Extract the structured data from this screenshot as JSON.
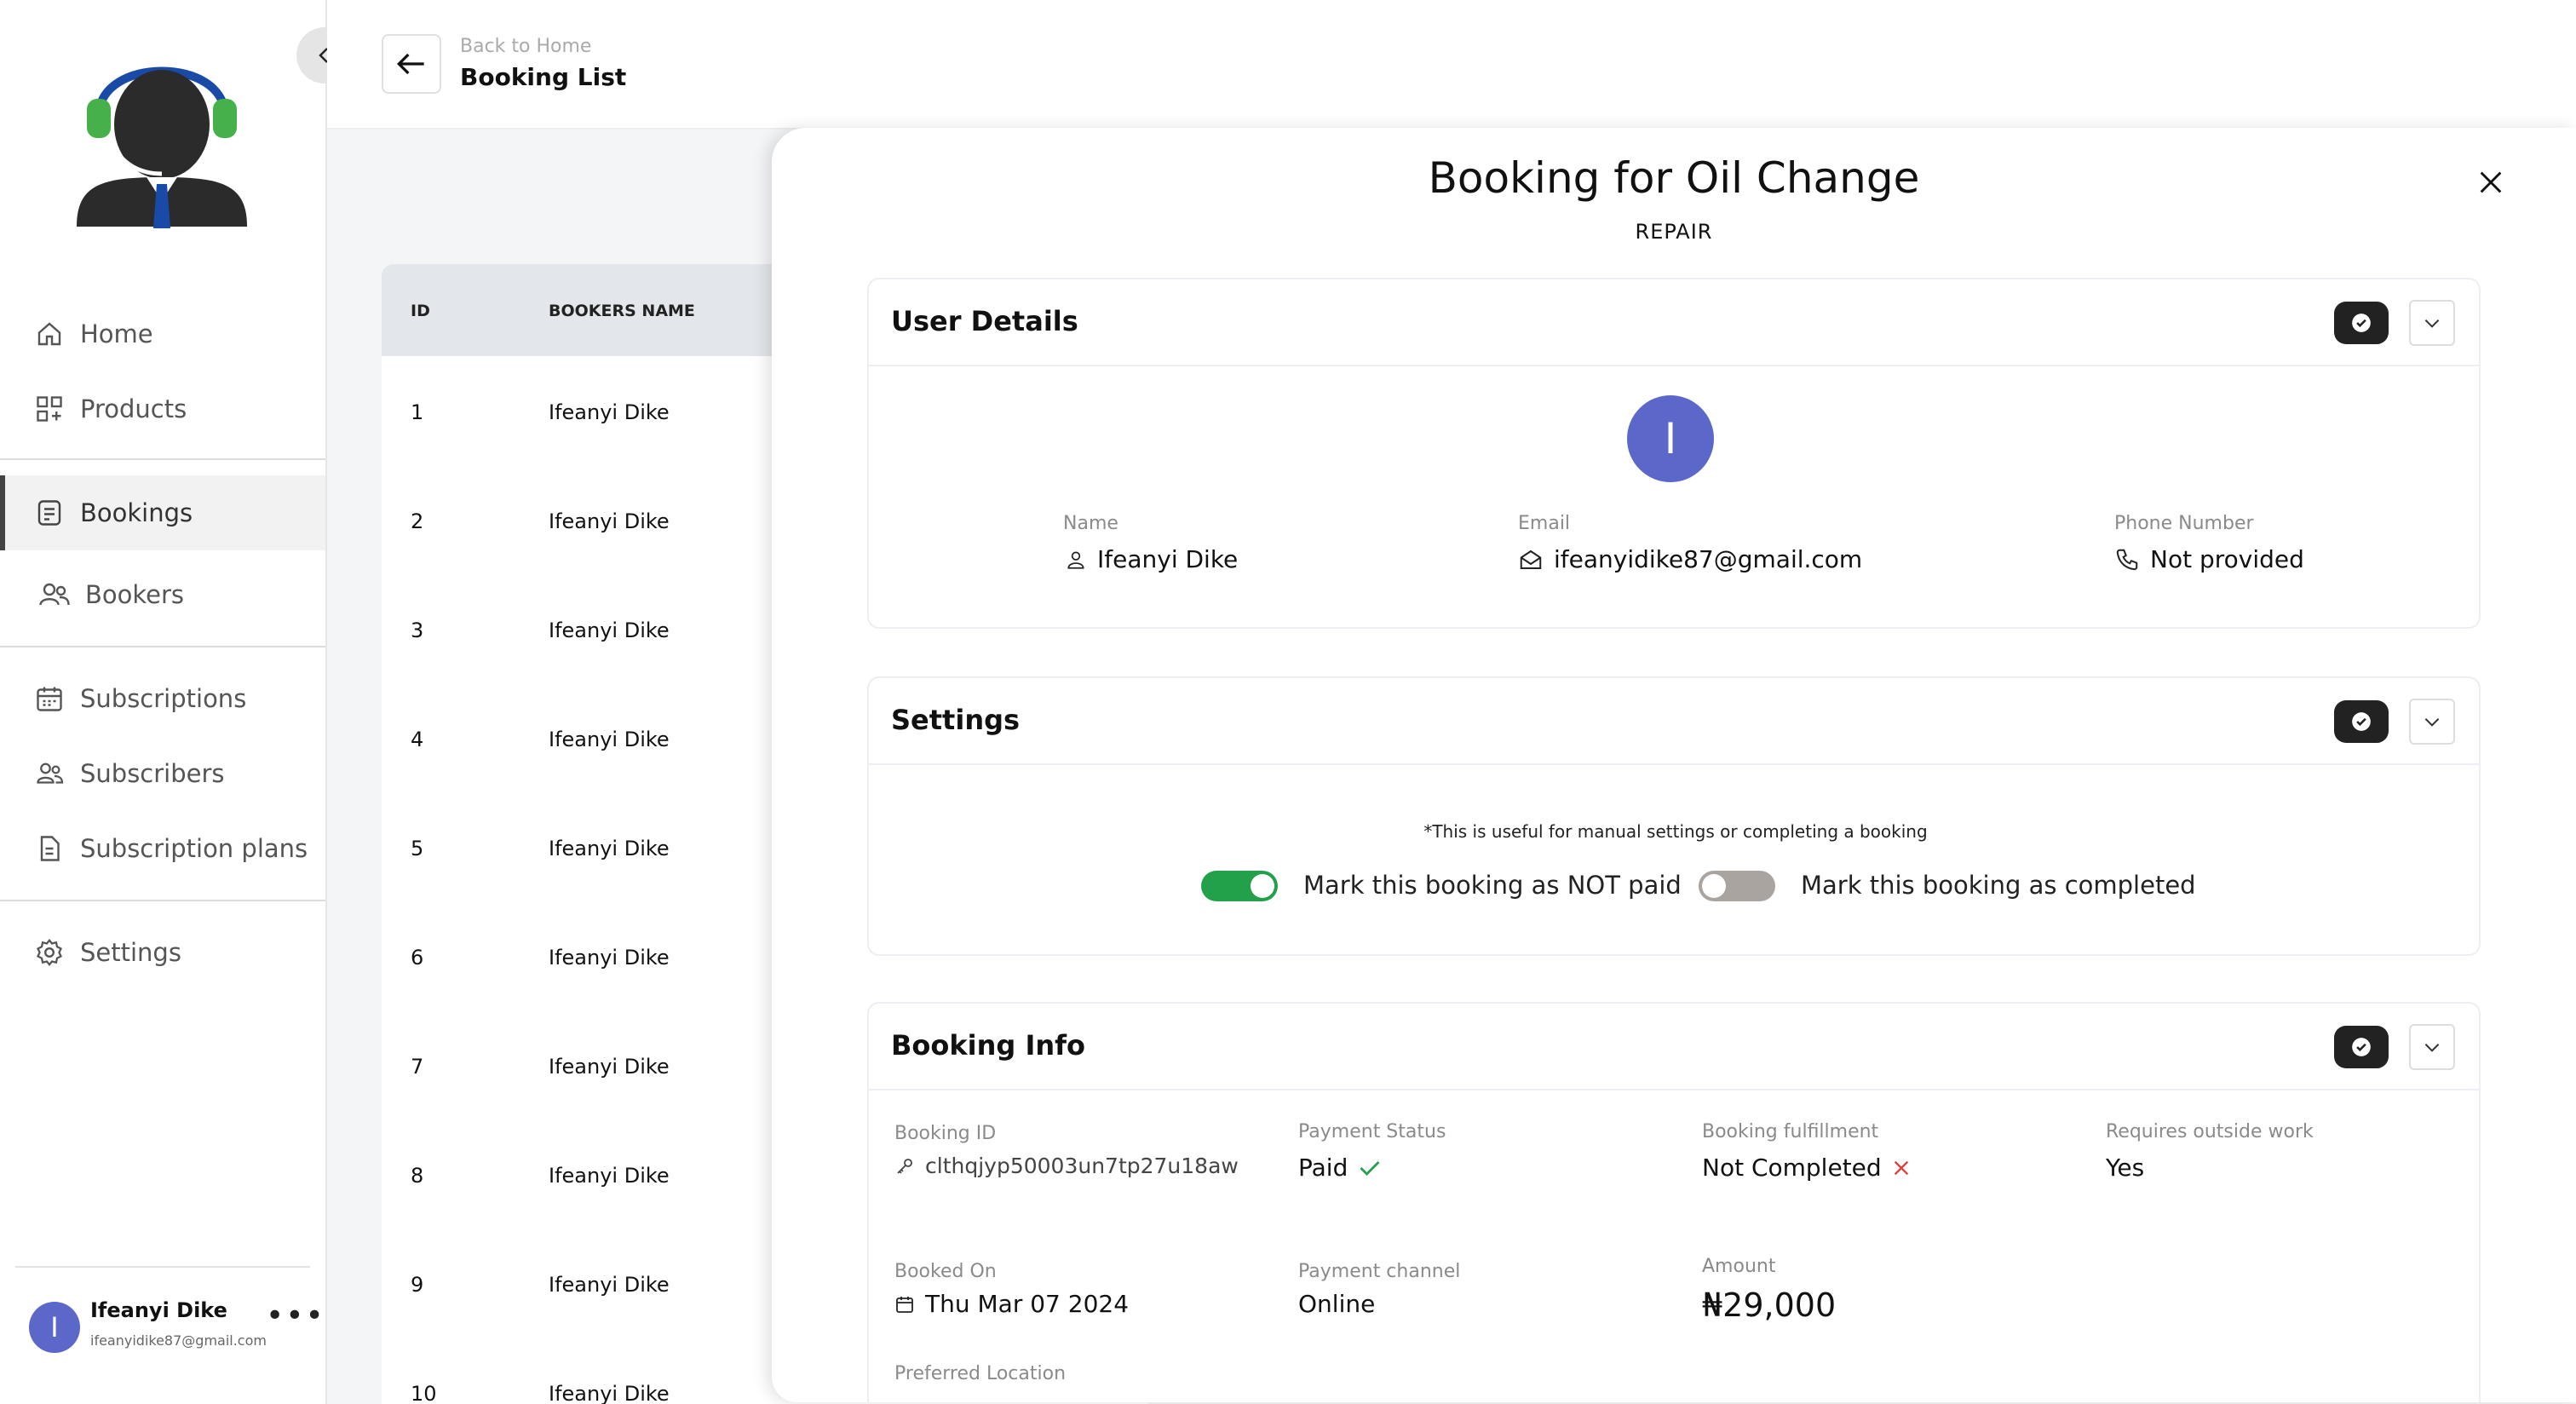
{
  "sidebar": {
    "items": [
      {
        "label": "Home"
      },
      {
        "label": "Products"
      },
      {
        "label": "Bookings"
      },
      {
        "label": "Bookers"
      },
      {
        "label": "Subscriptions"
      },
      {
        "label": "Subscribers"
      },
      {
        "label": "Subscription plans"
      },
      {
        "label": "Settings"
      }
    ],
    "active": "Bookings",
    "user": {
      "initial": "I",
      "name": "Ifeanyi Dike",
      "email": "ifeanyidike87@gmail.com"
    }
  },
  "header": {
    "back_label": "Back to Home",
    "title": "Booking List"
  },
  "table": {
    "columns": [
      "ID",
      "BOOKERS NAME"
    ],
    "rows": [
      {
        "id": "1",
        "name": "Ifeanyi Dike"
      },
      {
        "id": "2",
        "name": "Ifeanyi Dike"
      },
      {
        "id": "3",
        "name": "Ifeanyi Dike"
      },
      {
        "id": "4",
        "name": "Ifeanyi Dike"
      },
      {
        "id": "5",
        "name": "Ifeanyi Dike"
      },
      {
        "id": "6",
        "name": "Ifeanyi Dike"
      },
      {
        "id": "7",
        "name": "Ifeanyi Dike"
      },
      {
        "id": "8",
        "name": "Ifeanyi Dike"
      },
      {
        "id": "9",
        "name": "Ifeanyi Dike"
      },
      {
        "id": "10",
        "name": "Ifeanyi Dike"
      }
    ]
  },
  "modal": {
    "title": "Booking for Oil Change",
    "subtitle": "REPAIR",
    "user_details": {
      "title": "User Details",
      "initial": "I",
      "name_label": "Name",
      "name": "Ifeanyi Dike",
      "email_label": "Email",
      "email": "ifeanyidike87@gmail.com",
      "phone_label": "Phone Number",
      "phone": "Not provided"
    },
    "settings": {
      "title": "Settings",
      "note": "*This is useful for manual settings or completing a booking",
      "toggle_paid_label": "Mark this booking as NOT paid",
      "toggle_paid_on": true,
      "toggle_completed_label": "Mark this booking as completed",
      "toggle_completed_on": false
    },
    "booking_info": {
      "title": "Booking Info",
      "booking_id_label": "Booking ID",
      "booking_id": "clthqjyp50003un7tp27u18aw",
      "payment_status_label": "Payment Status",
      "payment_status": "Paid",
      "fulfillment_label": "Booking fulfillment",
      "fulfillment": "Not Completed",
      "outside_work_label": "Requires outside work",
      "outside_work": "Yes",
      "booked_on_label": "Booked On",
      "booked_on": "Thu Mar 07 2024",
      "channel_label": "Payment channel",
      "channel": "Online",
      "amount_label": "Amount",
      "amount": "₦29,000",
      "location_label": "Preferred Location"
    }
  },
  "colors": {
    "accent": "#5b67c9",
    "toggle_on": "#22a04a",
    "toggle_off": "#a9a49f",
    "success": "#22a04a",
    "danger": "#e53935"
  }
}
